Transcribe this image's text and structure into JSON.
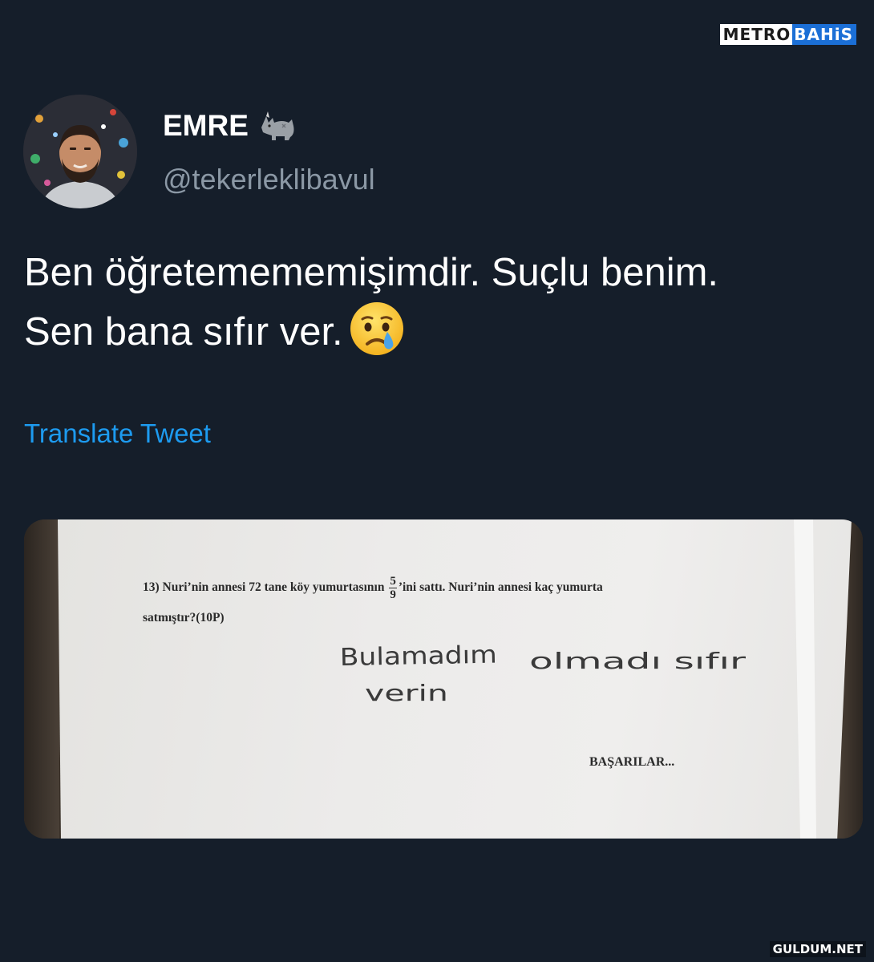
{
  "watermark_top": {
    "part1": "METRO",
    "part2": "BAHiS"
  },
  "user": {
    "display_name": "EMRE",
    "badge_icon": "rhino-icon",
    "handle": "@tekerleklibavul",
    "avatar_icon": "avatar-photo"
  },
  "tweet": {
    "line1": "Ben öğretemememişimdir. Suçlu benim.",
    "line2": "Sen bana sıfır ver.",
    "emoji": "crying-face-icon",
    "translate_label": "Translate Tweet"
  },
  "photo": {
    "question_line1_a": "13) Nuri’nin annesi 72 tane köy yumurtasının",
    "fraction_num": "5",
    "fraction_den": "9",
    "question_line1_b": "’ini sattı. Nuri’nin annesi kaç yumurta",
    "question_line2": "satmıştır?(10P)",
    "handwritten_line1": "Bulamadım olmadı sıfır",
    "handwritten_line2": "verin",
    "footer": "BAŞARILAR..."
  },
  "watermark_bottom": "GULDUM.NET",
  "colors": {
    "background": "#151e2a",
    "text": "#ffffff",
    "secondary_text": "#8b98a5",
    "link": "#1d9bf0"
  }
}
